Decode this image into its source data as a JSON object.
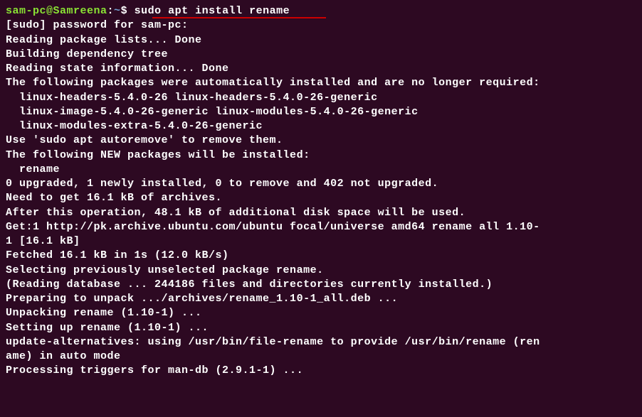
{
  "prompt": {
    "user_host": "sam-pc@Samreena",
    "separator": ":",
    "path": "~",
    "symbol": "$ ",
    "command": "sudo apt install rename"
  },
  "lines": [
    "[sudo] password for sam-pc:",
    "Reading package lists... Done",
    "Building dependency tree",
    "Reading state information... Done",
    "The following packages were automatically installed and are no longer required:",
    "  linux-headers-5.4.0-26 linux-headers-5.4.0-26-generic",
    "  linux-image-5.4.0-26-generic linux-modules-5.4.0-26-generic",
    "  linux-modules-extra-5.4.0-26-generic",
    "Use 'sudo apt autoremove' to remove them.",
    "The following NEW packages will be installed:",
    "  rename",
    "0 upgraded, 1 newly installed, 0 to remove and 402 not upgraded.",
    "Need to get 16.1 kB of archives.",
    "After this operation, 48.1 kB of additional disk space will be used.",
    "Get:1 http://pk.archive.ubuntu.com/ubuntu focal/universe amd64 rename all 1.10-",
    "1 [16.1 kB]",
    "Fetched 16.1 kB in 1s (12.0 kB/s)",
    "Selecting previously unselected package rename.",
    "(Reading database ... 244186 files and directories currently installed.)",
    "Preparing to unpack .../archives/rename_1.10-1_all.deb ...",
    "Unpacking rename (1.10-1) ...",
    "Setting up rename (1.10-1) ...",
    "update-alternatives: using /usr/bin/file-rename to provide /usr/bin/rename (ren",
    "ame) in auto mode",
    "Processing triggers for man-db (2.9.1-1) ..."
  ]
}
